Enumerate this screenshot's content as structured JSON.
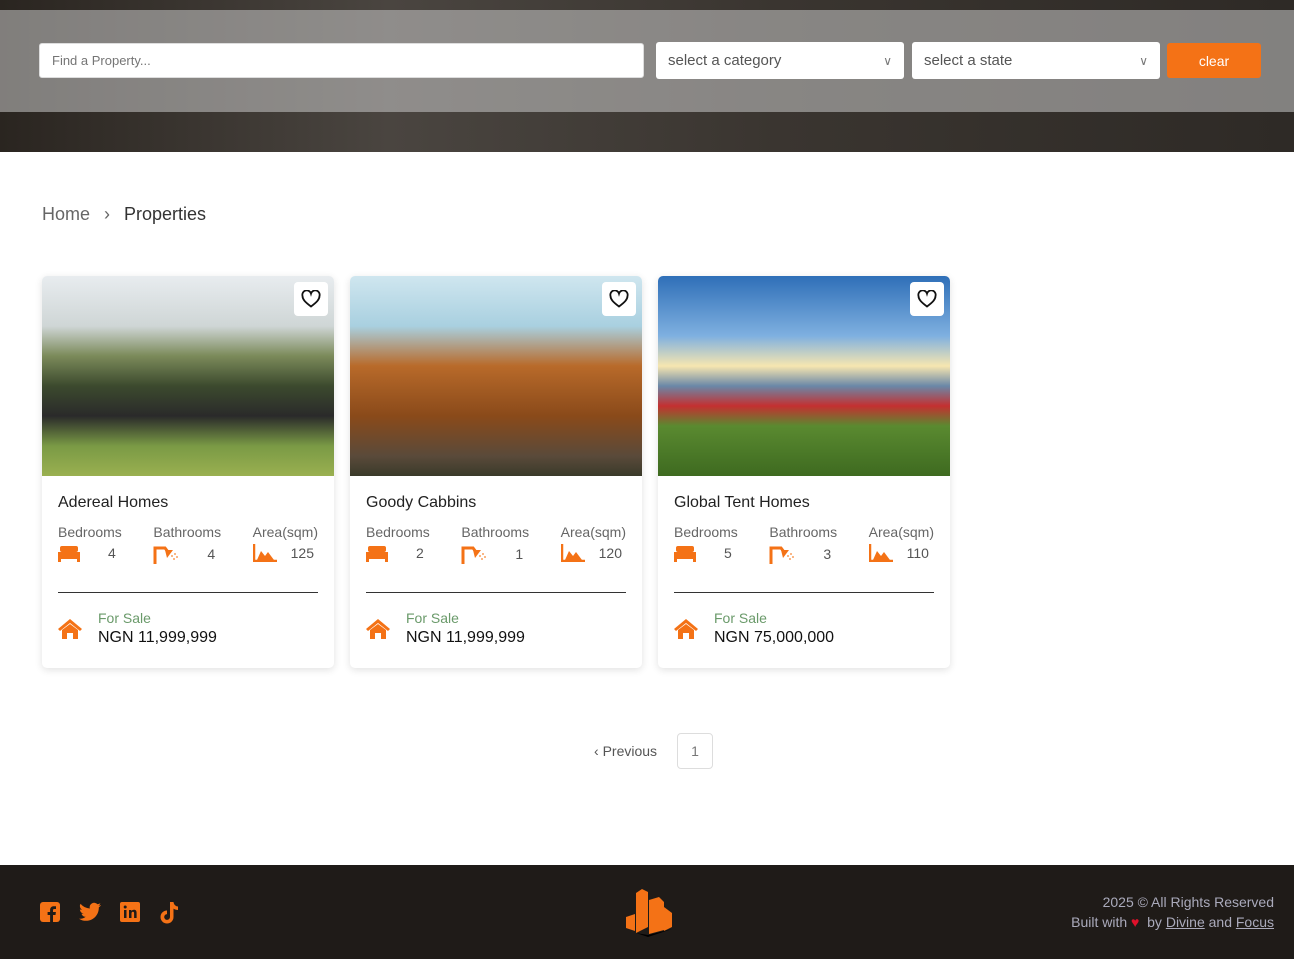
{
  "header": {
    "search_placeholder": "Find a Property...",
    "category_select": "select a category",
    "state_select": "select a state",
    "clear_label": "clear"
  },
  "breadcrumb": {
    "home": "Home",
    "separator": "›",
    "current": "Properties"
  },
  "properties": [
    {
      "name": "Adereal Homes",
      "bedrooms": "4",
      "bathrooms": "4",
      "area": "125",
      "status": "For Sale",
      "price": "NGN 11,999,999"
    },
    {
      "name": "Goody Cabbins",
      "bedrooms": "2",
      "bathrooms": "1",
      "area": "120",
      "status": "For Sale",
      "price": "NGN 11,999,999"
    },
    {
      "name": "Global Tent Homes",
      "bedrooms": "5",
      "bathrooms": "3",
      "area": "110",
      "status": "For Sale",
      "price": "NGN 75,000,000"
    }
  ],
  "labels": {
    "bedrooms": "Bedrooms",
    "bathrooms": "Bathrooms",
    "area": "Area(sqm)"
  },
  "pagination": {
    "previous": "Previous",
    "current_page": "1"
  },
  "footer": {
    "copyright": "2025 © All Rights Reserved",
    "built_with": "Built with",
    "by": "by",
    "author1": "Divine",
    "and": "and",
    "author2": "Focus"
  },
  "colors": {
    "accent": "#f47216",
    "footer_bg": "#1f1b18"
  }
}
